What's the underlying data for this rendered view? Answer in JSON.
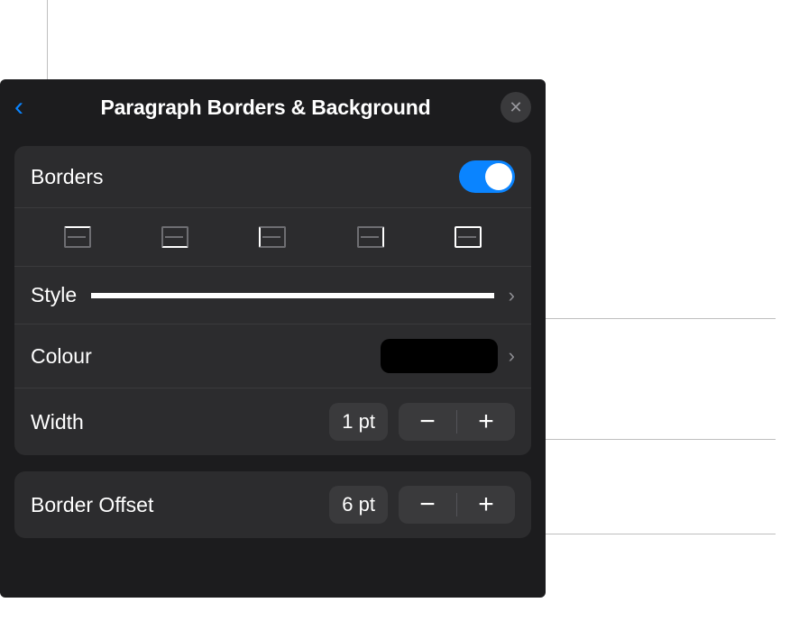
{
  "header": {
    "title": "Paragraph Borders & Background"
  },
  "borders": {
    "label": "Borders",
    "toggle": true
  },
  "style": {
    "label": "Style"
  },
  "colour": {
    "label": "Colour",
    "value": "#000000"
  },
  "width": {
    "label": "Width",
    "value": "1 pt"
  },
  "offset": {
    "label": "Border Offset",
    "value": "6 pt"
  },
  "icons": {
    "back": "‹",
    "close": "✕",
    "chevron": "›",
    "minus": "−",
    "plus": "+"
  }
}
